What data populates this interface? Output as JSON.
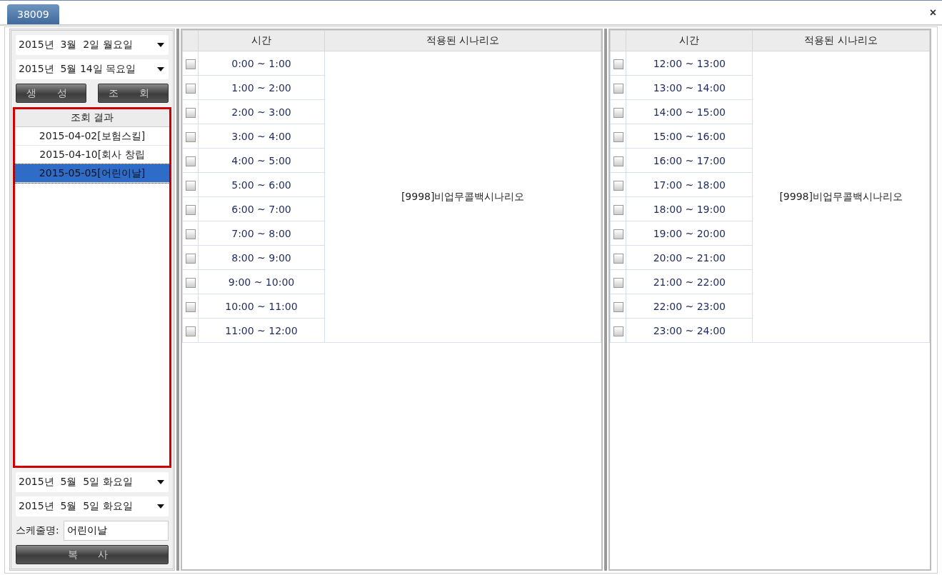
{
  "window": {
    "tab": "38009",
    "close": "×"
  },
  "search": {
    "start_date": "2015년  3월  2일 월요일",
    "end_date": "2015년  5월 14일 목요일",
    "buttons": [
      "생 성",
      "조 회"
    ]
  },
  "results": {
    "header": "조회 결과",
    "highlighted": true,
    "items": [
      {
        "label": "2015-04-02[보험스킬]",
        "selected": false
      },
      {
        "label": "2015-04-10[회사 창립",
        "selected": false
      },
      {
        "label": "2015-05-05[어린이날]",
        "selected": true
      }
    ]
  },
  "copy": {
    "start_date": "2015년  5월  5일 화요일",
    "end_date": "2015년  5월  5일 화요일",
    "name_label": "스케줄명:",
    "name_value": "어린이날",
    "button": "복 사"
  },
  "tables": [
    {
      "columns": [
        "시간",
        "적용된 시나리오"
      ],
      "scenario": "[9998]비업무콜백시나리오",
      "rows": [
        {
          "time": "0:00 ~ 1:00",
          "checked": false
        },
        {
          "time": "1:00 ~ 2:00",
          "checked": false
        },
        {
          "time": "2:00 ~ 3:00",
          "checked": false
        },
        {
          "time": "3:00 ~ 4:00",
          "checked": false
        },
        {
          "time": "4:00 ~ 5:00",
          "checked": false
        },
        {
          "time": "5:00 ~ 6:00",
          "checked": false
        },
        {
          "time": "6:00 ~ 7:00",
          "checked": false
        },
        {
          "time": "7:00 ~ 8:00",
          "checked": false
        },
        {
          "time": "8:00 ~ 9:00",
          "checked": false
        },
        {
          "time": "9:00 ~ 10:00",
          "checked": false
        },
        {
          "time": "10:00 ~ 11:00",
          "checked": false
        },
        {
          "time": "11:00 ~ 12:00",
          "checked": false
        }
      ]
    },
    {
      "columns": [
        "시간",
        "적용된 시나리오"
      ],
      "scenario": "[9998]비업무콜백시나리오",
      "rows": [
        {
          "time": "12:00 ~ 13:00",
          "checked": false
        },
        {
          "time": "13:00 ~ 14:00",
          "checked": false
        },
        {
          "time": "14:00 ~ 15:00",
          "checked": false
        },
        {
          "time": "15:00 ~ 16:00",
          "checked": false
        },
        {
          "time": "16:00 ~ 17:00",
          "checked": false
        },
        {
          "time": "17:00 ~ 18:00",
          "checked": false
        },
        {
          "time": "18:00 ~ 19:00",
          "checked": false
        },
        {
          "time": "19:00 ~ 20:00",
          "checked": false
        },
        {
          "time": "20:00 ~ 21:00",
          "checked": false
        },
        {
          "time": "21:00 ~ 22:00",
          "checked": false
        },
        {
          "time": "22:00 ~ 23:00",
          "checked": false
        },
        {
          "time": "23:00 ~ 24:00",
          "checked": false
        }
      ]
    }
  ]
}
